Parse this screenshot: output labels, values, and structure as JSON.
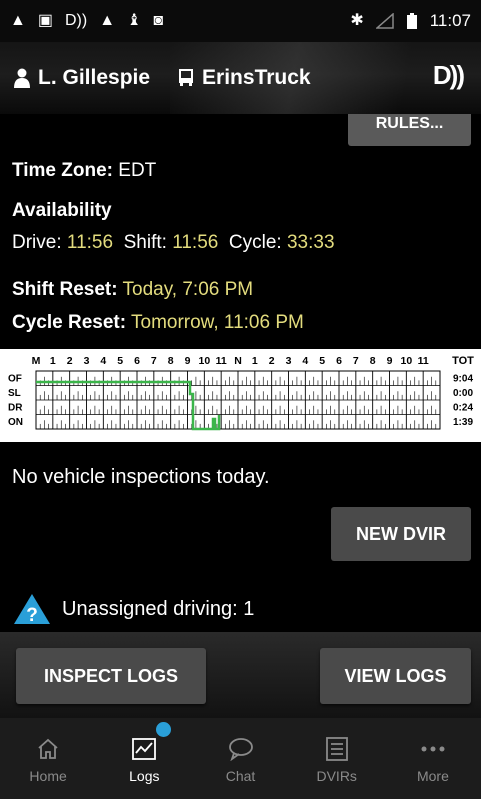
{
  "status_bar": {
    "time": "11:07",
    "left_icons": [
      "alert-icon",
      "image-icon",
      "eld-signal-icon",
      "alert-icon",
      "usb-icon",
      "android-icon"
    ],
    "right_icons": [
      "bluetooth-icon",
      "signal-icon",
      "battery-icon"
    ]
  },
  "app_bar": {
    "driver_name": "L. Gillespie",
    "truck_name": "ErinsTruck",
    "driver_icon": "person-icon",
    "truck_icon": "truck-icon",
    "connection_icon": "eld-connection-icon"
  },
  "rules_button": {
    "label": "RULES..."
  },
  "time_zone": {
    "label": "Time Zone:",
    "value": "EDT"
  },
  "availability": {
    "title": "Availability",
    "drive_label": "Drive:",
    "drive_value": "11:56",
    "shift_label": "Shift:",
    "shift_value": "11:56",
    "cycle_label": "Cycle:",
    "cycle_value": "33:33"
  },
  "shift_reset": {
    "label": "Shift Reset:",
    "value": "Today, 7:06 PM"
  },
  "cycle_reset": {
    "label": "Cycle Reset:",
    "value": "Tomorrow, 11:06 PM"
  },
  "log_chart": {
    "hour_labels": [
      "M",
      "1",
      "2",
      "3",
      "4",
      "5",
      "6",
      "7",
      "8",
      "9",
      "10",
      "11",
      "N",
      "1",
      "2",
      "3",
      "4",
      "5",
      "6",
      "7",
      "8",
      "9",
      "10",
      "11"
    ],
    "total_header": "TOT",
    "rows": [
      {
        "label": "OF",
        "total": "9:04"
      },
      {
        "label": "SL",
        "total": "0:00"
      },
      {
        "label": "DR",
        "total": "0:24"
      },
      {
        "label": "ON",
        "total": "1:39"
      }
    ],
    "line_color": "#3bb54a"
  },
  "inspections": {
    "message": "No vehicle inspections today."
  },
  "new_dvir_button": {
    "label": "NEW DVIR"
  },
  "unassigned": {
    "text": "Unassigned driving: 1"
  },
  "inspect_logs_button": {
    "label": "INSPECT LOGS"
  },
  "view_logs_button": {
    "label": "VIEW LOGS"
  },
  "nav": {
    "items": [
      {
        "label": "Home"
      },
      {
        "label": "Logs"
      },
      {
        "label": "Chat"
      },
      {
        "label": "DVIRs"
      },
      {
        "label": "More"
      }
    ]
  },
  "colors": {
    "accent_yellow": "#e3dc7e",
    "badge_blue": "#2a9fd8",
    "log_green": "#3bb54a"
  }
}
